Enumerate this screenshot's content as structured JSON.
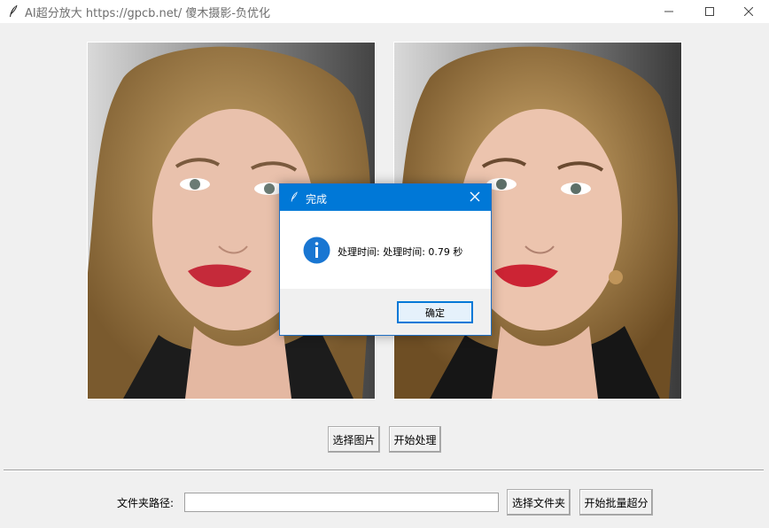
{
  "window": {
    "title": "AI超分放大 https://gpcb.net/ 傻木摄影-负优化",
    "icons": {
      "app": "feather-icon",
      "minimize": "minimize-icon",
      "maximize": "maximize-icon",
      "close": "close-icon"
    }
  },
  "images": {
    "left": {
      "description_name": "original-image-preview"
    },
    "right": {
      "description_name": "upscaled-image-preview"
    }
  },
  "controls": {
    "select_image_label": "选择图片",
    "start_process_label": "开始处理"
  },
  "batch": {
    "folder_label": "文件夹路径:",
    "folder_value": "",
    "select_folder_label": "选择文件夹",
    "start_batch_label": "开始批量超分"
  },
  "dialog": {
    "title": "完成",
    "message": "处理时间: 处理时间: 0.79 秒",
    "ok_label": "确定",
    "icon": "info-icon"
  },
  "colors": {
    "window_bg": "#f0f0f0",
    "dialog_title_bg": "#0078d7",
    "info_icon": "#1976d2"
  }
}
